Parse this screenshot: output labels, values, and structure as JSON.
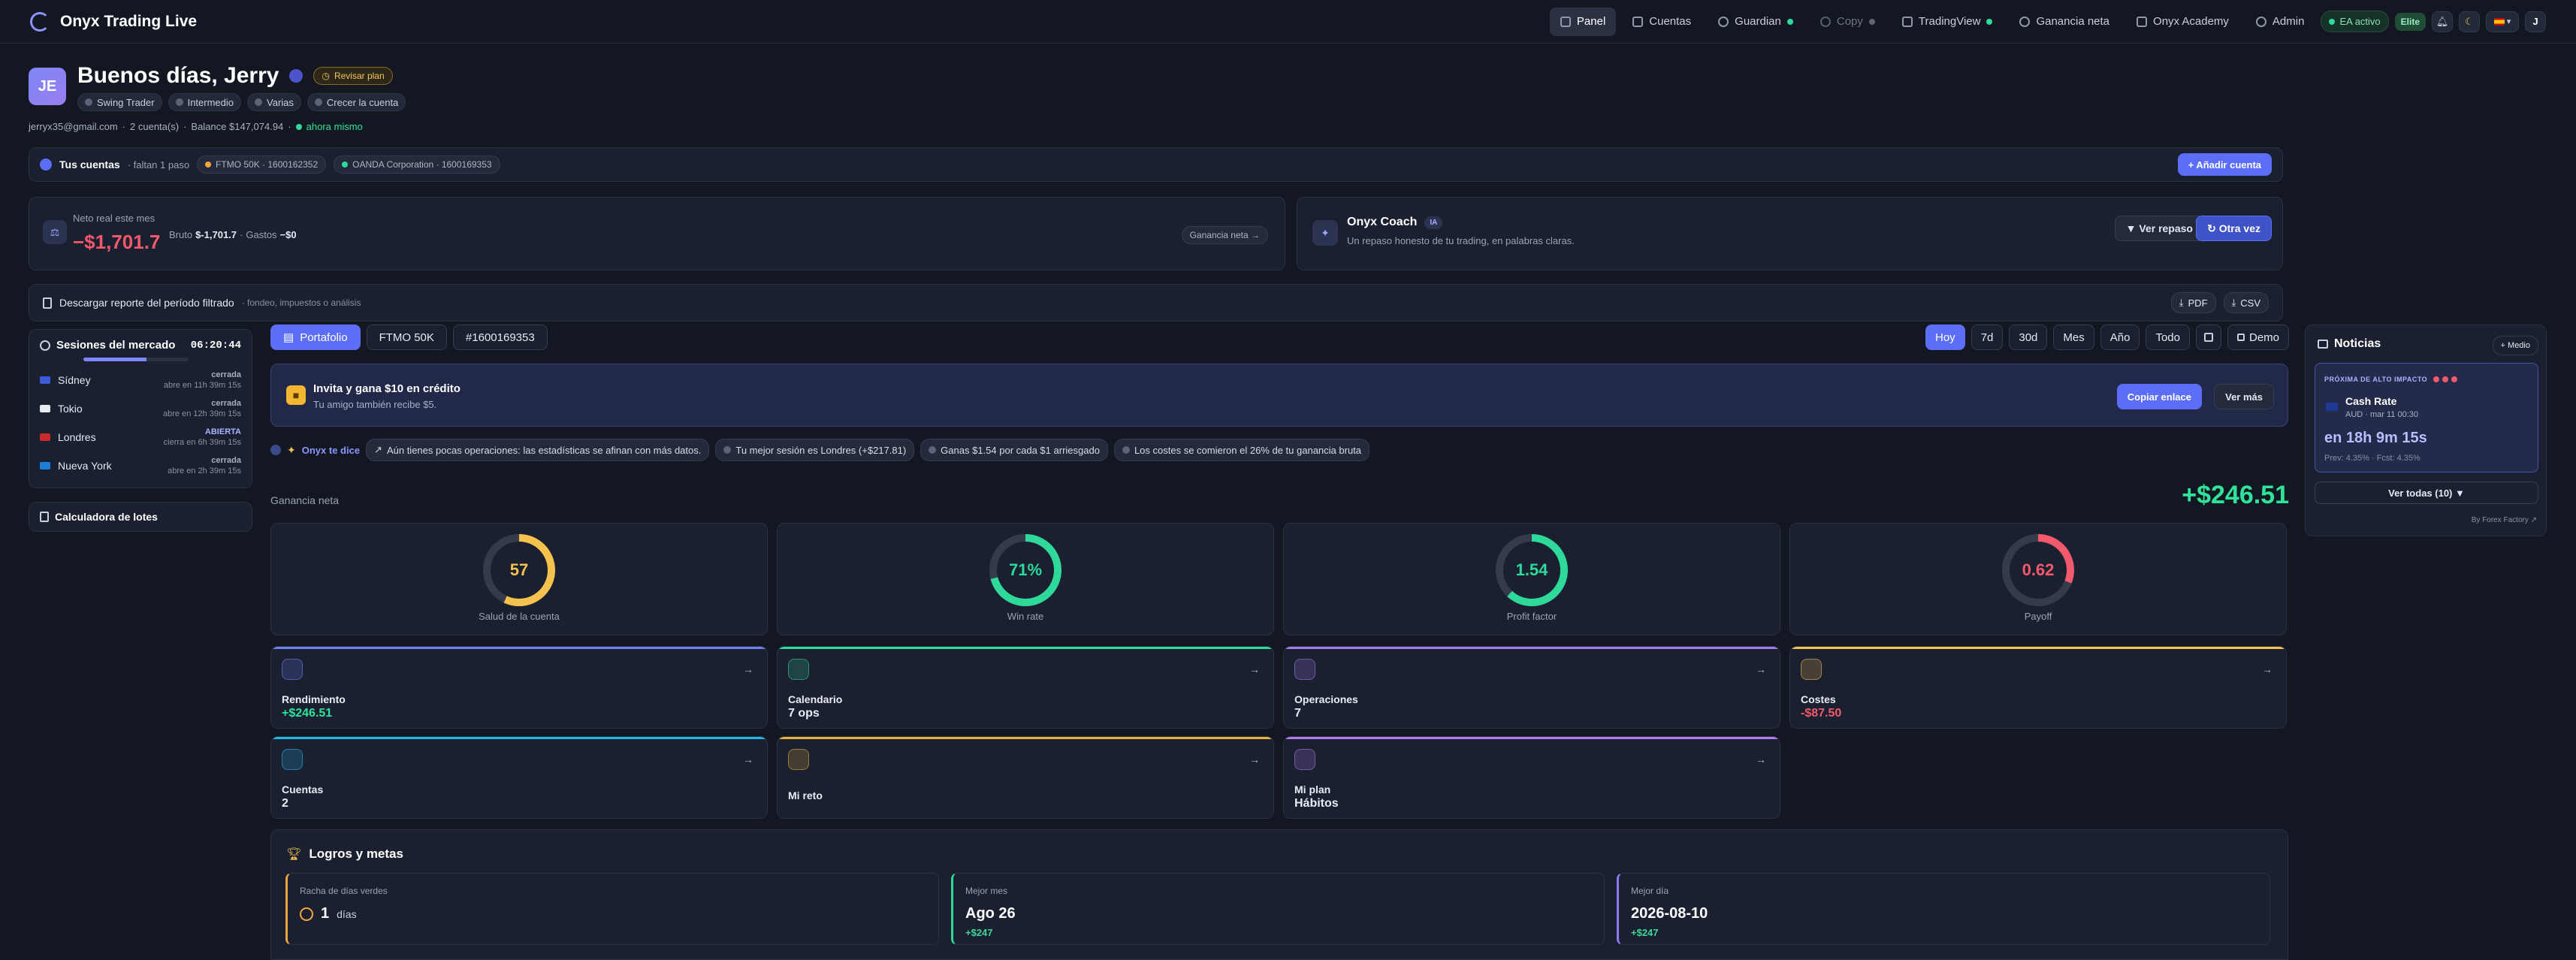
{
  "app": {
    "title": "Onyx Trading Live"
  },
  "nav": {
    "items": [
      {
        "label": "Panel",
        "active": true,
        "status": ""
      },
      {
        "label": "Cuentas",
        "status": ""
      },
      {
        "label": "Guardian",
        "status": "green"
      },
      {
        "label": "Copy",
        "status": "gray",
        "dim": true
      },
      {
        "label": "TradingView",
        "status": "green"
      },
      {
        "label": "Ganancia neta",
        "status": ""
      },
      {
        "label": "Onyx Academy",
        "status": ""
      },
      {
        "label": "Admin",
        "status": ""
      }
    ],
    "ea_status": "EA activo",
    "elite_badge": "Elite",
    "user_initial": "J"
  },
  "profile": {
    "initials": "JE",
    "greeting": "Buenos días, Jerry",
    "review_button": "Revisar plan",
    "tags": [
      "Swing Trader",
      "Intermedio",
      "Varias",
      "Crecer la cuenta"
    ],
    "email": "jerryx35@gmail.com",
    "accounts_count": "2 cuenta(s)",
    "balance": "Balance $147,074.94",
    "updated": "ahora mismo"
  },
  "accounts_bar": {
    "title": "Tus cuentas",
    "progress": "· faltan 1 paso",
    "accounts": [
      "FTMO 50K · 1600162352",
      "OANDA Corporation · 1600169353"
    ],
    "add_button": "+ Añadir cuenta"
  },
  "net_card": {
    "label": "Neto real este mes",
    "value": "−$1,701.7",
    "gross_label": "Bruto",
    "gross": "$-1,701.7",
    "costs_label": "Gastos",
    "costs": "−$0",
    "link": "Ganancia neta →"
  },
  "coach": {
    "title": "Onyx Coach",
    "badge": "IA",
    "subtitle": "Un repaso honesto de tu trading, en palabras claras.",
    "review_button": "▼ Ver repaso",
    "again_button": "↻ Otra vez"
  },
  "report": {
    "title": "Descargar reporte del período filtrado",
    "subtitle": "· fondeo, impuestos o análisis",
    "pdf": "PDF",
    "csv": "CSV"
  },
  "sessions": {
    "title": "Sesiones del mercado",
    "clock": "06:20:44",
    "progress": 0.6,
    "items": [
      {
        "name": "Sídney",
        "state": "cerrada",
        "detail": "abre en 11h 39m 15s",
        "color": "#3b5bdb"
      },
      {
        "name": "Tokio",
        "state": "cerrada",
        "detail": "abre en 12h 39m 15s",
        "color": "#e9ecef"
      },
      {
        "name": "Londres",
        "state": "ABIERTA",
        "detail": "cierra en 6h 39m 15s",
        "color": "#c92a2a",
        "open": true
      },
      {
        "name": "Nueva York",
        "state": "cerrada",
        "detail": "abre en 2h 39m 15s",
        "color": "#1c7ed6"
      }
    ]
  },
  "lot_calc": {
    "label": "Calculadora de lotes"
  },
  "tabs": {
    "items": [
      "Portafolio",
      "FTMO 50K",
      "#1600169353"
    ],
    "active": 0
  },
  "periods": {
    "items": [
      "Hoy",
      "7d",
      "30d",
      "Mes",
      "Año",
      "Todo"
    ],
    "active": 0,
    "calendar_icon": "calendar-icon",
    "demo": "Demo"
  },
  "invite": {
    "title": "Invita y gana $10 en crédito",
    "subtitle": "Tu amigo también recibe $5.",
    "copy_button": "Copiar enlace",
    "more_button": "Ver más"
  },
  "tips": {
    "label": "Onyx te dice",
    "items": [
      "Aún tienes pocas operaciones: las estadísticas se afinan con más datos.",
      "Tu mejor sesión es Londres (+$217.81)",
      "Ganas $1.54 por cada $1 arriesgado",
      "Los costes se comieron el 26% de tu ganancia bruta"
    ]
  },
  "net_profit": {
    "label": "Ganancia neta",
    "value": "+$246.51"
  },
  "gauges": [
    {
      "value": "57",
      "label": "Salud de la cuenta",
      "fraction": 0.57,
      "color": "#f5c24e"
    },
    {
      "value": "71%",
      "label": "Win rate",
      "fraction": 0.71,
      "color": "#2fd99a"
    },
    {
      "value": "1.54",
      "label": "Profit factor",
      "fraction": 0.62,
      "color": "#2fd99a"
    },
    {
      "value": "0.62",
      "label": "Payoff",
      "fraction": 0.31,
      "color": "#f2596d"
    }
  ],
  "tiles": [
    {
      "title": "Rendimiento",
      "value": "+$246.51",
      "color": "#6f7ff7",
      "vcolor": "green"
    },
    {
      "title": "Calendario",
      "value": "7 ops",
      "color": "#2fd99a",
      "vcolor": ""
    },
    {
      "title": "Operaciones",
      "value": "7",
      "color": "#a57cf0",
      "vcolor": ""
    },
    {
      "title": "Costes",
      "value": "-$87.50",
      "color": "#f5c24e",
      "vcolor": "red"
    },
    {
      "title": "Cuentas",
      "value": "2",
      "color": "#22b8e6",
      "vcolor": ""
    },
    {
      "title": "Mi reto",
      "value": "",
      "color": "#e6b23c",
      "vcolor": ""
    },
    {
      "title": "Mi plan",
      "value": "Hábitos",
      "color": "#b27cf0",
      "vcolor": ""
    }
  ],
  "achievements": {
    "title": "Logros y metas",
    "items": [
      {
        "label": "Racha de días verdes",
        "value": "1",
        "unit": "días",
        "sub": "",
        "color": "#f5a540"
      },
      {
        "label": "Mejor mes",
        "value": "Ago 26",
        "sub": "+$247",
        "color": "#2fd99a"
      },
      {
        "label": "Mejor día",
        "value": "2026-08-10",
        "sub": "+$247",
        "color": "#8b7cf5"
      }
    ]
  },
  "news": {
    "title": "Noticias",
    "filter": "+ Medio",
    "impact_label": "PRÓXIMA DE ALTO IMPACTO",
    "event": "Cash Rate",
    "event_meta": "AUD · mar 11 00:30",
    "countdown": "en 18h 9m 15s",
    "forecast": "Prev: 4.35% · Fcst: 4.35%",
    "view_all": "Ver todas (10) ▼",
    "source": "By Forex Factory ↗"
  }
}
